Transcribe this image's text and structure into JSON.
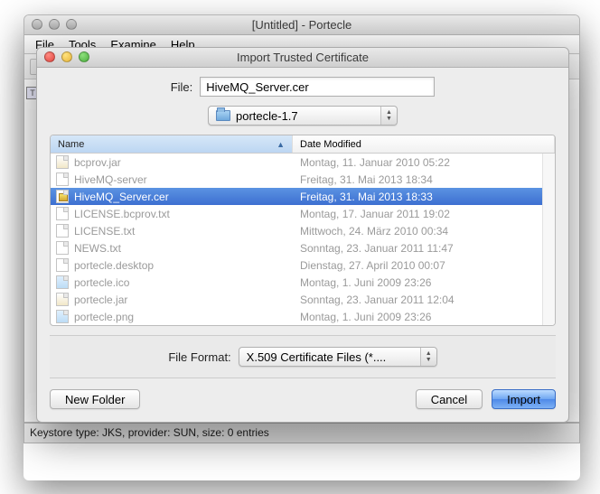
{
  "main_window": {
    "title": "[Untitled] - Portecle",
    "menu": {
      "file": "File",
      "tools": "Tools",
      "examine": "Examine",
      "help": "Help"
    },
    "statusbar": "Keystore type: JKS, provider: SUN, size: 0 entries",
    "left_marker": "T"
  },
  "dialog": {
    "title": "Import Trusted Certificate",
    "file_label": "File:",
    "file_value": "HiveMQ_Server.cer",
    "folder_popup": "portecle-1.7",
    "columns": {
      "name": "Name",
      "date": "Date Modified"
    },
    "files": [
      {
        "name": "bcprov.jar",
        "date": "Montag, 11. Januar 2010 05:22",
        "type": "jar",
        "sel": false
      },
      {
        "name": "HiveMQ-server",
        "date": "Freitag, 31. Mai 2013 18:34",
        "type": "doc",
        "sel": false
      },
      {
        "name": "HiveMQ_Server.cer",
        "date": "Freitag, 31. Mai 2013 18:33",
        "type": "cer",
        "sel": true
      },
      {
        "name": "LICENSE.bcprov.txt",
        "date": "Montag, 17. Januar 2011 19:02",
        "type": "doc",
        "sel": false
      },
      {
        "name": "LICENSE.txt",
        "date": "Mittwoch, 24. März 2010 00:34",
        "type": "doc",
        "sel": false
      },
      {
        "name": "NEWS.txt",
        "date": "Sonntag, 23. Januar 2011 11:47",
        "type": "doc",
        "sel": false
      },
      {
        "name": "portecle.desktop",
        "date": "Dienstag, 27. April 2010 00:07",
        "type": "doc",
        "sel": false
      },
      {
        "name": "portecle.ico",
        "date": "Montag, 1. Juni 2009 23:26",
        "type": "img",
        "sel": false
      },
      {
        "name": "portecle.jar",
        "date": "Sonntag, 23. Januar 2011 12:04",
        "type": "jar",
        "sel": false
      },
      {
        "name": "portecle.png",
        "date": "Montag, 1. Juni 2009 23:26",
        "type": "img",
        "sel": false
      }
    ],
    "format_label": "File Format:",
    "format_value": "X.509 Certificate Files (*....",
    "buttons": {
      "new_folder": "New Folder",
      "cancel": "Cancel",
      "import": "Import"
    }
  }
}
